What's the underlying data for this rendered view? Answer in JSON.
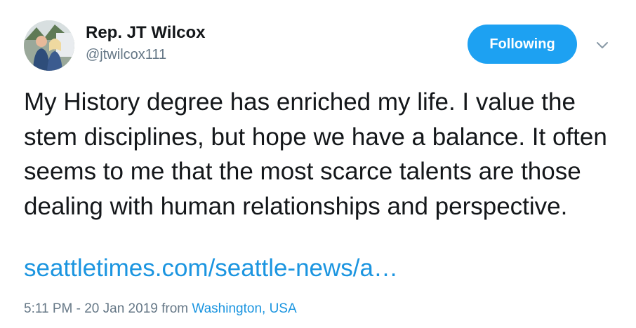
{
  "user": {
    "display_name": "Rep. JT Wilcox",
    "handle": "@jtwilcox111"
  },
  "actions": {
    "follow_label": "Following",
    "menu_icon": "chevron-down-icon"
  },
  "tweet": {
    "text": "My History degree has enriched my life.  I value the stem disciplines, but hope we have a balance.  It often seems to me that the most scarce talents are those dealing with human relationships and perspective.",
    "link": "seattletimes.com/seattle-news/a…"
  },
  "meta": {
    "timestamp": "5:11 PM - 20 Jan 2019",
    "from_word": "from",
    "location": "Washington, USA"
  },
  "colors": {
    "accent": "#1da1f2",
    "link": "#1b95e0",
    "secondary_text": "#657786",
    "primary_text": "#14171a"
  }
}
